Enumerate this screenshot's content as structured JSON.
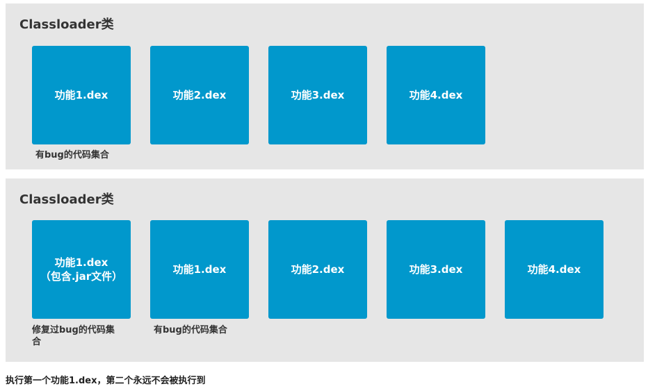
{
  "colors": {
    "panel_bg": "#e6e6e6",
    "box_bg": "#0198cc",
    "box_text": "#ffffff",
    "caption_text": "#333333"
  },
  "top_panel": {
    "title": "Classloader类",
    "boxes": [
      {
        "label": "功能1.dex"
      },
      {
        "label": "功能2.dex"
      },
      {
        "label": "功能3.dex"
      },
      {
        "label": "功能4.dex"
      }
    ],
    "captions": [
      "有bug的代码集合"
    ]
  },
  "bottom_panel": {
    "title": "Classloader类",
    "boxes": [
      {
        "label": "功能1.dex",
        "sublabel": "（包含.jar文件）"
      },
      {
        "label": "功能1.dex"
      },
      {
        "label": "功能2.dex"
      },
      {
        "label": "功能3.dex"
      },
      {
        "label": "功能4.dex"
      }
    ],
    "captions": [
      "修复过bug的代码集合",
      "有bug的代码集合"
    ]
  },
  "footnote": "执行第一个功能1.dex，第二个永远不会被执行到"
}
